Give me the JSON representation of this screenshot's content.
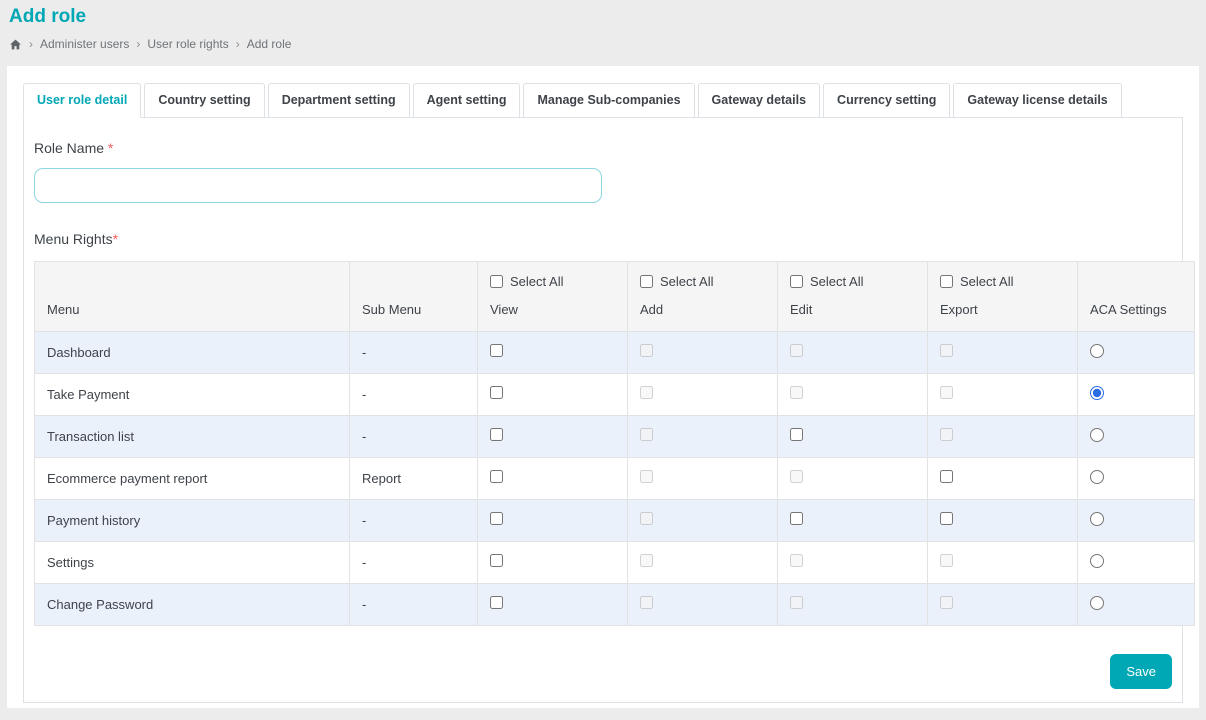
{
  "page": {
    "title": "Add role"
  },
  "breadcrumb": {
    "separator": "›",
    "items": [
      "Administer users",
      "User role rights",
      "Add role"
    ]
  },
  "tabs": [
    {
      "label": "User role detail",
      "active": true
    },
    {
      "label": "Country setting",
      "active": false
    },
    {
      "label": "Department setting",
      "active": false
    },
    {
      "label": "Agent setting",
      "active": false
    },
    {
      "label": "Manage Sub-companies",
      "active": false
    },
    {
      "label": "Gateway details",
      "active": false
    },
    {
      "label": "Currency setting",
      "active": false
    },
    {
      "label": "Gateway license details",
      "active": false
    }
  ],
  "form": {
    "role_name_label": "Role Name",
    "required_mark": "*",
    "role_name_value": "",
    "menu_rights_label": "Menu Rights"
  },
  "table": {
    "select_all_label": "Select All",
    "columns": [
      "Menu",
      "Sub Menu",
      "View",
      "Add",
      "Edit",
      "Export",
      "ACA Settings"
    ],
    "rows": [
      {
        "menu": "Dashboard",
        "sub_menu": "-",
        "view": {
          "enabled": true,
          "checked": false
        },
        "add": {
          "enabled": false,
          "checked": false
        },
        "edit": {
          "enabled": false,
          "checked": false
        },
        "export": {
          "enabled": false,
          "checked": false
        },
        "aca_checked": false
      },
      {
        "menu": "Take Payment",
        "sub_menu": "-",
        "view": {
          "enabled": true,
          "checked": false
        },
        "add": {
          "enabled": false,
          "checked": false
        },
        "edit": {
          "enabled": false,
          "checked": false
        },
        "export": {
          "enabled": false,
          "checked": false
        },
        "aca_checked": true
      },
      {
        "menu": "Transaction list",
        "sub_menu": "-",
        "view": {
          "enabled": true,
          "checked": false
        },
        "add": {
          "enabled": false,
          "checked": false
        },
        "edit": {
          "enabled": true,
          "checked": false
        },
        "export": {
          "enabled": false,
          "checked": false
        },
        "aca_checked": false
      },
      {
        "menu": "Ecommerce payment report",
        "sub_menu": "Report",
        "view": {
          "enabled": true,
          "checked": false
        },
        "add": {
          "enabled": false,
          "checked": false
        },
        "edit": {
          "enabled": false,
          "checked": false
        },
        "export": {
          "enabled": true,
          "checked": false
        },
        "aca_checked": false
      },
      {
        "menu": "Payment history",
        "sub_menu": "-",
        "view": {
          "enabled": true,
          "checked": false
        },
        "add": {
          "enabled": false,
          "checked": false
        },
        "edit": {
          "enabled": true,
          "checked": false
        },
        "export": {
          "enabled": true,
          "checked": false
        },
        "aca_checked": false
      },
      {
        "menu": "Settings",
        "sub_menu": "-",
        "view": {
          "enabled": true,
          "checked": false
        },
        "add": {
          "enabled": false,
          "checked": false
        },
        "edit": {
          "enabled": false,
          "checked": false
        },
        "export": {
          "enabled": false,
          "checked": false
        },
        "aca_checked": false
      },
      {
        "menu": "Change Password",
        "sub_menu": "-",
        "view": {
          "enabled": true,
          "checked": false
        },
        "add": {
          "enabled": false,
          "checked": false
        },
        "edit": {
          "enabled": false,
          "checked": false
        },
        "export": {
          "enabled": false,
          "checked": false
        },
        "aca_checked": false
      }
    ]
  },
  "save_button": "Save",
  "colors": {
    "accent": "#00a7b5",
    "row_alt": "#eaf1fb",
    "radio_checked": "#2b6be4",
    "required": "#ef5b5b"
  }
}
